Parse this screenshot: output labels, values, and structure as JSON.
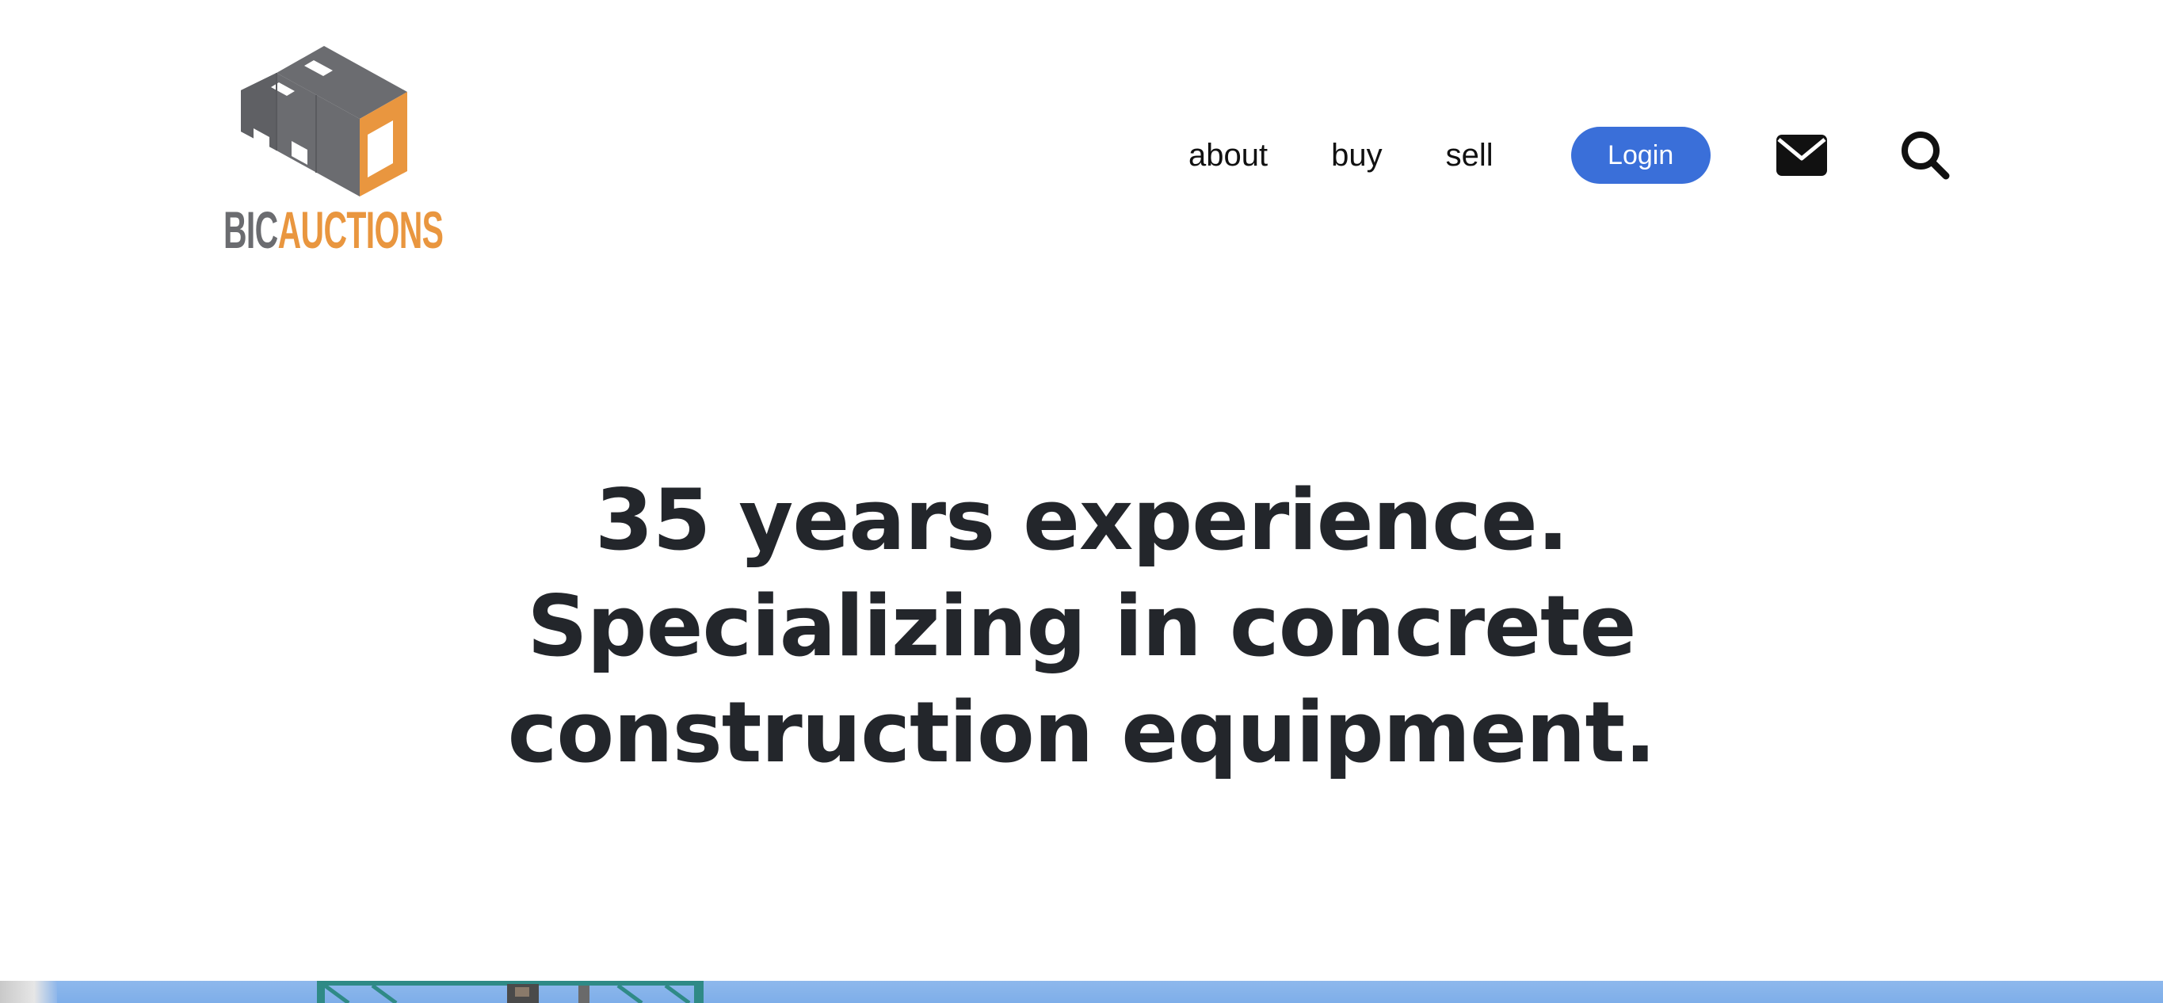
{
  "header": {
    "logo": {
      "text_part1": "BIC",
      "text_part2": "AUCTIONS",
      "colors": {
        "gray": "#6b6c70",
        "orange": "#e9963f"
      }
    },
    "nav": {
      "items": [
        {
          "label": "about"
        },
        {
          "label": "buy"
        },
        {
          "label": "sell"
        }
      ],
      "login_label": "Login",
      "mail_icon": "envelope-icon",
      "search_icon": "search-icon"
    }
  },
  "hero": {
    "lines": [
      "35 years experience.",
      "Specializing in concrete",
      "construction equipment."
    ]
  },
  "colors": {
    "accent": "#3a6fd9",
    "heading": "#23262b",
    "sky": "#8eb8ec",
    "crane": "#2f8a86"
  }
}
